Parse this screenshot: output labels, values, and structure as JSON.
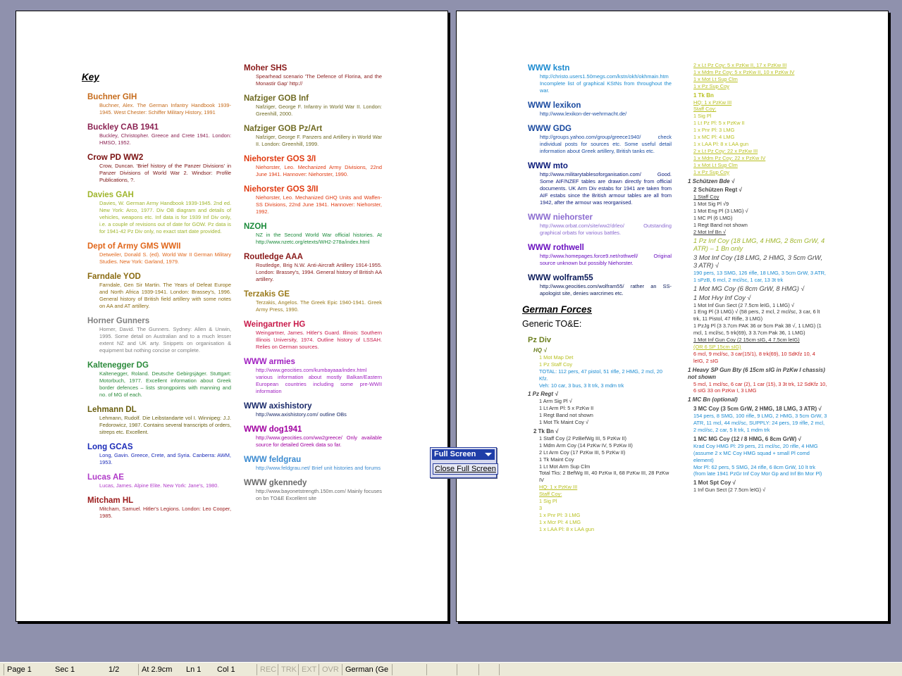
{
  "colors": {
    "desktop": "#8f91ad",
    "statusbar": "#ece9d8",
    "toolbar_title": "#1f3ea8"
  },
  "page1": {
    "key_heading": "Key",
    "col1": [
      {
        "head": "Buchner GIH",
        "color": "#c66b1b",
        "body": "Buchner, Alex. The German Infantry Handbook 1939-1945. West Chester: Schiffer Military History, 1991"
      },
      {
        "head": "Buckley CAB 1941",
        "color": "#8b2252",
        "body": "Buckley, Christopher. Greece and Crete 1941. London: HMSO, 1952."
      },
      {
        "head": "Crow PD WW2",
        "color": "#7a1010",
        "body": "Crow, Duncan. 'Brief history of the Panzer Divisions' in Panzer Divisions of World War 2. Windsor: Profile Publications, ?."
      },
      {
        "head": "Davies GAH",
        "color": "#9fb52c",
        "body": "Davies, W. German Army Handbook 1939-1945. 2nd ed. New York: Arco, 1977. Div OB diagram and details of vehicles, weapons etc. Inf data is for 1939 Inf Div only, i.e. a couple of revisions out of date for GOW. Pz data is for 1941-42 Pz Div only, no exact start date provided."
      },
      {
        "head": "Dept of Army GMS WWII",
        "color": "#e0661a",
        "body": "Detweiler, Donald S. (ed). World War II German Military Studies. New York: Garland, 1979."
      },
      {
        "head": "Farndale YOD",
        "color": "#8a6a10",
        "body": "Farndale, Gen Sir Martin. The Years of Defeat Europe and North Africa 1939-1941. London: Brassey's, 1996. General history of British field artillery with some notes on AA and AT artillery."
      },
      {
        "head": "Horner Gunners",
        "color": "#808080",
        "body": "Horner, David. The Gunners. Sydney: Allen & Unwin, 1995. Some detail on Australian and to a much lesser extent NZ and UK arty. Snippets on organisation & equipment but nothing concise or complete."
      },
      {
        "head": "Kaltenegger DG",
        "color": "#2a8a3a",
        "body": "Kaltenegger, Roland. Deutsche Gebirgsjäger. Stuttgart: Motorbuch, 1977. Excellent information about Greek border defences – lists strongpoints with manning and no. of MG of each."
      },
      {
        "head": "Lehmann DL",
        "color": "#6a5f10",
        "body": "Lehmann, Rudolf. Die Leibstandarte vol I. Winnipeg: J.J. Fedorowicz, 1987. Contains several transcripts of orders, sitreps etc. Excellent."
      },
      {
        "head": "Long GCAS",
        "color": "#1a2ab8",
        "body": "Long, Gavin. Greece, Crete, and Syria. Canberra: AWM, 1953."
      },
      {
        "head": "Lucas AE",
        "color": "#b03ac8",
        "body": "Lucas, James. Alpine Elite. New York: Jane's, 1980."
      },
      {
        "head": "Mitcham HL",
        "color": "#9a1a1a",
        "body": "Mitcham, Samuel. Hitler's Legions. London: Leo Cooper, 1985."
      }
    ],
    "col2": [
      {
        "head": "Moher SHS",
        "color": "#8a1a1a",
        "body": "Spearhead scenario 'The Defence of Florina, and the Monastir Gap' http://"
      },
      {
        "head": "Nafziger GOB Inf",
        "color": "#6f6a22",
        "body": "Nafziger, George F. Infantry in World War II. London: Greenhill, 2000."
      },
      {
        "head": "Nafziger GOB Pz/Art",
        "color": "#6f6a22",
        "body": "Nafziger, George F. Panzers and Artillery in World War II. London: Greenhill, 1999."
      },
      {
        "head": "Niehorster GOS 3/I",
        "color": "#e03a10",
        "body": "Niehorster, Leo. Mechanized Army Divisions, 22nd June 1941. Hannover: Niehorster, 1990."
      },
      {
        "head": "Niehorster GOS 3/II",
        "color": "#e03a10",
        "body": "Niehorster, Leo. Mechanized GHQ Units and Waffen-SS Divisions, 22nd June 1941. Hannover: Niehorster, 1992."
      },
      {
        "head": "NZOH",
        "color": "#1a8a3a",
        "body": "NZ in the Second World War official histories. At http://www.nzetc.org/etexts/WH2-278a/index.html"
      },
      {
        "head": "Routledge AAA",
        "color": "#8a1a1a",
        "body": "Routledge, Brig N.W. Anti-Aircraft Artillery 1914-1955. London: Brassey's, 1994. General history of British AA artillery."
      },
      {
        "head": "Terzakis GE",
        "color": "#9a7a1a",
        "body": "Terzakis, Angelos. The Greek Epic 1940-1941. Greek Army Press, 1990."
      },
      {
        "head": "Weingartner HG",
        "color": "#c81a4a",
        "body": "Weingartner, James. Hitler's Guard. Illinois: Southern Illinois University, 1974. Outline history of LSSAH. Relies on German sources."
      },
      {
        "head": "WWW armies",
        "color": "#a020c0",
        "body": "http://www.geocities.com/kumbayaaa/index.html various information about mostly Balkan/Eastern European countries including some pre-WWII information"
      },
      {
        "head": "WWW axishistory",
        "color": "#1a2a6a",
        "body": "http://www.axishistory.com/ outline OBs"
      },
      {
        "head": "WWW dog1941",
        "color": "#a000a0",
        "body": "http://www.geocities.com/ww2greece/ Only available source for detailed Greek data so far."
      },
      {
        "head": "WWW feldgrau",
        "color": "#3a8ad0",
        "body": "http://www.feldgrau.net/ Brief unit histories and forums"
      },
      {
        "head": "WWW gkennedy",
        "color": "#6a6a6a",
        "body": "http://www.bayonetstrength.150m.com/ Mainly focuses on bn TO&E Excellent site"
      }
    ]
  },
  "page2": {
    "col1_entries": [
      {
        "head": "WWW kstn",
        "color": "#1a8ad0",
        "body": "http://christo.users1.50megs.com/kstn/okh/okhmain.htm Incomplete list of graphical KStNs from throughout the war."
      },
      {
        "head": "WWW lexikon",
        "color": "#1a4aa0",
        "body": "http://www.lexikon-der-wehrmacht.de/"
      },
      {
        "head": "WWW GDG",
        "color": "#1a4aa0",
        "body": "http://groups.yahoo.com/group/greece1940/ check individual posts for sources etc. Some useful detail information about Greek artillery, British tanks etc."
      },
      {
        "head": "WWW mto",
        "color": "#0a1a7a",
        "body": "http://www.militarytablesoforganisation.com/ Good. Some AIF/NZEF tables are drawn directly from official documents. UK Arm Div estabs for 1941 are taken from AIF estabs since the British armour tables are all from 1942, after the armour was reorganised."
      },
      {
        "head": "WWW niehorster",
        "color": "#8a6ad0",
        "body": "http://www.orbat.com/site/ww2/drleo/ Outstanding graphical orbats for various battles."
      },
      {
        "head": "WWW rothwell",
        "color": "#6a10c0",
        "body": "http://www.homepages.force9.net/rothwell/ Original source unknown but possibly Niehorster."
      },
      {
        "head": "WWW wolfram55",
        "color": "#0a1a5a",
        "body": "http://www.geocities.com/wolfram55/ rather an SS-apologist site, denies warcrimes etc."
      }
    ],
    "german_forces_heading": "German Forces",
    "generic_toe": "Generic TO&E:",
    "pz_div": "Pz Div",
    "col1_lines": [
      {
        "t": "HQ √",
        "c": "#6c7f1f",
        "cls": "hdi i1"
      },
      {
        "t": "1 Mot Map Det",
        "c": "#b8c020",
        "cls": "i2"
      },
      {
        "t": "1 Pz Staff Coy",
        "c": "#b8c020",
        "cls": "i2"
      },
      {
        "t": "TOTAL: 112 pers, 47 pistol, 51 rifle, 2 HMG, 2 mcl, 20 Kfz.",
        "c": "#1a8ad0",
        "cls": "i2"
      },
      {
        "t": "Veh: 10 car, 3 bus, 3 lt trk, 3 mdm trk",
        "c": "#1a8ad0",
        "cls": "i2"
      },
      {
        "t": "1 Pz Regt √",
        "c": "#444",
        "cls": "hdi"
      },
      {
        "t": "1 Arm Sig Pl √",
        "c": "#333",
        "cls": "i2"
      },
      {
        "t": "1 Lt Arm Pl: 5 x PzKw II",
        "c": "#333",
        "cls": "i2"
      },
      {
        "t": "1 Regt Band not shown",
        "c": "#333",
        "cls": "i2"
      },
      {
        "t": "1 Mot Tk Maint Coy √",
        "c": "#333",
        "cls": "i2"
      },
      {
        "t": "2 Tk Bn √",
        "c": "#444",
        "cls": "hd i1"
      },
      {
        "t": "1 Staff Coy (2 PzBefWg III, 5 PzKw II)",
        "c": "#333",
        "cls": "i2"
      },
      {
        "t": "1 Mdm Arm Coy (14 PzKw IV, 5 PzKw II)",
        "c": "#333",
        "cls": "i2"
      },
      {
        "t": "2 Lt Arm Coy (17 PzKw III, 5 PzKw II)",
        "c": "#333",
        "cls": "i2"
      },
      {
        "t": "1 Tk Maint Coy",
        "c": "#333",
        "cls": "i2"
      },
      {
        "t": "1 Lt Mot Arm Sup Clm",
        "c": "#333",
        "cls": "i2"
      },
      {
        "t": "Total Tks: 2 BefWg III, 40 PzKw II, 68 PzKw III, 28 PzKw IV",
        "c": "#333",
        "cls": "i2"
      },
      {
        "t": "HQ: 1 x PzKw III",
        "c": "#b8c020",
        "cls": "i2 u"
      },
      {
        "t": "Staff Coy:",
        "c": "#b8c020",
        "cls": "i2 u"
      },
      {
        "t": "1 Sig Pl",
        "c": "#b8c020",
        "cls": "i2"
      },
      {
        "t": "3",
        "c": "#b8c020",
        "cls": "i2"
      },
      {
        "t": "1 x Pnr Pl: 3 LMG",
        "c": "#b8c020",
        "cls": "i2"
      },
      {
        "t": "1 x Mcr Pl: 4 LMG",
        "c": "#b8c020",
        "cls": "i2"
      },
      {
        "t": "1 x LAA Pl: 8 x LAA gun",
        "c": "#b8c020",
        "cls": "i2"
      }
    ],
    "col2_lines": [
      {
        "t": "2 x Lt Pz Coy: 5 x PzKw II, 17 x PzKw III",
        "c": "#b8c020",
        "cls": "i1 u"
      },
      {
        "t": "1 x Mdm Pz Coy: 5 x PzKw II, 10 x PzKw IV",
        "c": "#b8c020",
        "cls": "i1 u"
      },
      {
        "t": "1 x Mot Lt Sup Clm",
        "c": "#b8c020",
        "cls": "i1 u"
      },
      {
        "t": "1 x Pz Sup Coy",
        "c": "#b8c020",
        "cls": "i1 u"
      },
      {
        "t": "1 Tk Bn",
        "c": "#b8c020",
        "cls": "hd i1"
      },
      {
        "t": "HQ: 1 x PzKw III",
        "c": "#b8c020",
        "cls": "i1 u"
      },
      {
        "t": "Staff Coy:",
        "c": "#b8c020",
        "cls": "i1 u"
      },
      {
        "t": "1 Sig Pl",
        "c": "#b8c020",
        "cls": "i1"
      },
      {
        "t": "1 Lt Pz Pl: 5 x PzKw II",
        "c": "#b8c020",
        "cls": "i1"
      },
      {
        "t": "1 x Pnr Pl: 3 LMG",
        "c": "#b8c020",
        "cls": "i1"
      },
      {
        "t": "1 x MC Pl: 4 LMG",
        "c": "#b8c020",
        "cls": "i1"
      },
      {
        "t": "1 x LAA Pl: 8 x LAA gun",
        "c": "#b8c020",
        "cls": "i1"
      },
      {
        "t": "2 x Lt Pz Coy: 22 x PzKw III",
        "c": "#b8c020",
        "cls": "i1 u"
      },
      {
        "t": "1 x Mdm Pz Coy: 22 x PzKw IV",
        "c": "#b8c020",
        "cls": "i1 u"
      },
      {
        "t": "1 x Mot Lt Sup Clm",
        "c": "#b8c020",
        "cls": "i1 u"
      },
      {
        "t": "1 x Pz Sup Coy",
        "c": "#b8c020",
        "cls": "i1 u"
      },
      {
        "t": "1 Schützen Bde √",
        "c": "#444",
        "cls": "hdi"
      },
      {
        "t": "2 Schützen Regt √",
        "c": "#444",
        "cls": "hd i1"
      },
      {
        "t": "1 Staff Coy",
        "c": "#333",
        "cls": "i1 u"
      },
      {
        "t": "1 Mot Sig Pl √9",
        "c": "#333",
        "cls": "i1"
      },
      {
        "t": "1 Mot Eng Pl (3 LMG) √",
        "c": "#333",
        "cls": "i1"
      },
      {
        "t": "1 MC Pl (6 LMG)",
        "c": "#333",
        "cls": "i1"
      },
      {
        "t": "1 Regt Band not shown",
        "c": "#333",
        "cls": "i1"
      },
      {
        "t": "2 Mot Inf Bn √",
        "c": "#333",
        "cls": "i1 u"
      },
      {
        "t": "1 Pz Inf Coy (18 LMG, 4 HMG, 2 8cm GrW, 4 ATR) – 1 Bn only",
        "c": "#9fb52c",
        "cls": "big i1"
      },
      {
        "t": "3 Mot Inf Coy (18 LMG, 2 HMG, 3 5cm GrW, 3 ATR) √",
        "c": "#444",
        "cls": "big i1"
      },
      {
        "t": "190 pers, 13 SMG, 126 rifle, 18 LMG, 3 5cm GrW, 3 ATR, 1 sPzB, 6 mcl, 2 mcl/sc, 1 car, 13 3t trk",
        "c": "#1a8ad0",
        "cls": "i1"
      },
      {
        "t": "1 Mot MG Coy (6 8cm GrW, 8 HMG) √",
        "c": "#444",
        "cls": "big i1"
      },
      {
        "t": "1 Mot Hvy Inf Coy √",
        "c": "#444",
        "cls": "big i1"
      },
      {
        "t": "1 Mot Inf Gun Sect (2 7.5cm leIG, 1 LMG) √",
        "c": "#333",
        "cls": "i1"
      },
      {
        "t": "1 Eng Pl (3 LMG) √ (58 pers, 2 mcl, 2 mcl/sc, 3 car, 6 lt trk, 11 Pistol, 47 Rifle, 3 LMG)",
        "c": "#333",
        "cls": "i1"
      },
      {
        "t": "1 PzJg Pl (3 3.7cm PAK 36 or 5cm Pak 38 √, 1 LMG) (1 mcl, 1 mcl/sc, 5 trk(69), 3 3.7cm Pak 36, 1 LMG)",
        "c": "#333",
        "cls": "i1"
      },
      {
        "t": "1 Mot Inf Gun Coy (2 15cm sIG, 4 7.5cm leIG)",
        "c": "#333",
        "cls": "i1 u"
      },
      {
        "t": "(OR 6 SP 15cm sIG)",
        "c": "#b8c020",
        "cls": "i1 u"
      },
      {
        "t": "6 mcl, 9 mcl/sc, 3 car(15/1), 8 trk(69), 10 SdKfz 10, 4 leIG, 2 sIG",
        "c": "#c81a1a",
        "cls": "i1"
      },
      {
        "t": "1 Heavy SP Gun Bty (6 15cm sIG in PzKw I chassis) not shown",
        "c": "#444",
        "cls": "hdi"
      },
      {
        "t": "5 mcl, 1 mcl/sc, 6 car (2), 1 car (15), 3 3t trk, 12 SdKfz 10, 6 sIG 33 on PzKw I, 3 LMG",
        "c": "#c81a1a",
        "cls": "i1"
      },
      {
        "t": "1 MC Bn (optional)",
        "c": "#444",
        "cls": "hdi"
      },
      {
        "t": "3 MC Coy (3 5cm GrW, 2 HMG, 18 LMG, 3 ATR) √",
        "c": "#444",
        "cls": "hd i1"
      },
      {
        "t": "154 pers, 8 SMG, 100 rifle, 9 LMG, 2 HMG, 3 5cm GrW, 3 ATR, 11 mcl, 44 mcl/sc, SUPPLY: 24 pers, 19 rifle, 2 mcl, 2 mcl/sc, 2 car, 5 lt trk, 1 mdm trk",
        "c": "#1a8ad0",
        "cls": "i1"
      },
      {
        "t": "1 MC MG Coy (12 / 8 HMG, 6 8cm GrW) √",
        "c": "#444",
        "cls": "hd i1"
      },
      {
        "t": "Krad Coy HMG Pl: 29 pers, 21 mcl/sc, 20 rifle, 4 HMG (assume 2 x MC Coy HMG squad + small Pl comd element)",
        "c": "#1a8ad0",
        "cls": "i1"
      },
      {
        "t": "Mor Pl: 62 pers, 5 SMG, 24 rifle, 6 8cm GrW, 10 lt trk",
        "c": "#1a8ad0",
        "cls": "i1"
      },
      {
        "t": "(from late 1941 PzGr Inf Coy Mor Gp and Inf Bn Mor Pl)",
        "c": "#1a8ad0",
        "cls": "i1"
      },
      {
        "t": "1 Mot Spt Coy √",
        "c": "#444",
        "cls": "hd i1"
      },
      {
        "t": "1 Inf Gun Sect (2 7.5cm leIG) √",
        "c": "#333",
        "cls": "i1"
      }
    ]
  },
  "toolbar": {
    "title": "Full Screen",
    "close_label": "Close Full Screen"
  },
  "statusbar": {
    "page": "Page  1",
    "sec": "Sec  1",
    "pages": "1/2",
    "at": "At  2.9cm",
    "ln": "Ln  1",
    "col": "Col  1",
    "rec": "REC",
    "trk": "TRK",
    "ext": "EXT",
    "ovr": "OVR",
    "lang": "German (Ge"
  }
}
